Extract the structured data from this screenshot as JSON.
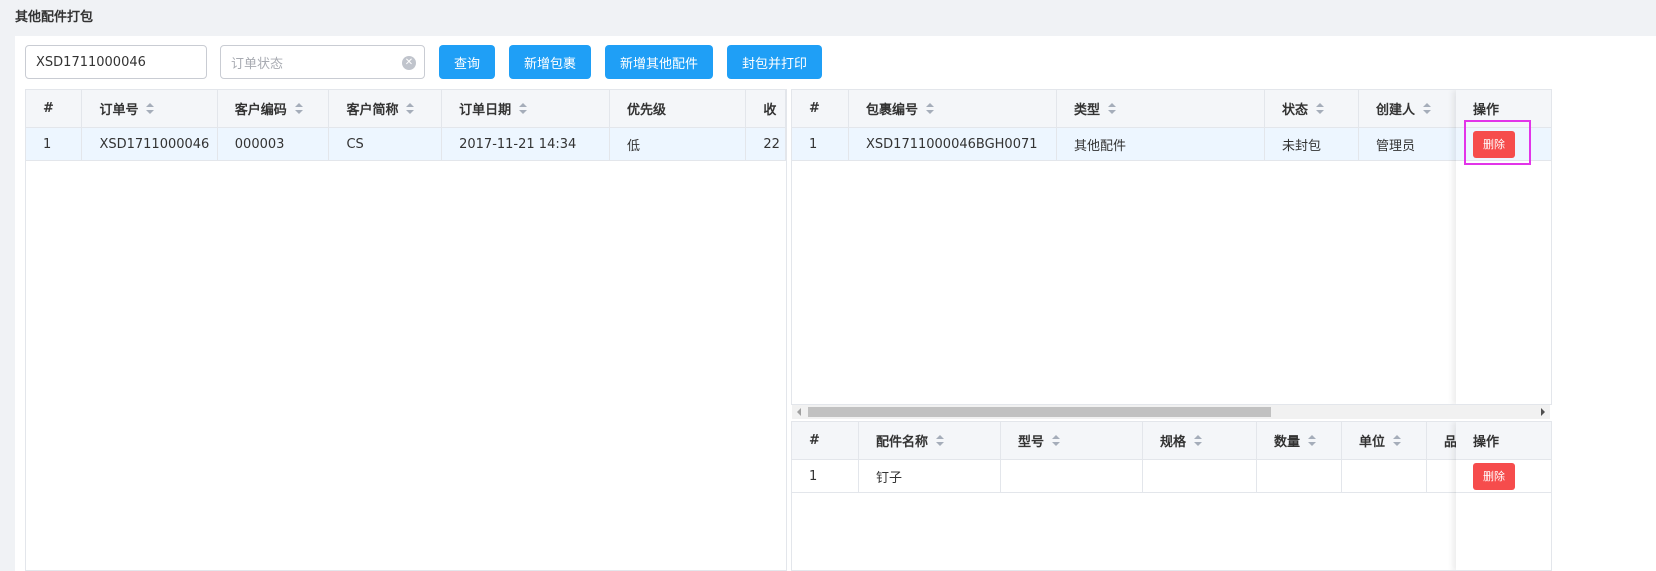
{
  "page": {
    "title": "其他配件打包"
  },
  "search": {
    "order_value": "XSD1711000046",
    "status_placeholder": "订单状态"
  },
  "buttons": {
    "query": "查询",
    "add_package": "新增包裹",
    "add_other_parts": "新增其他配件",
    "seal_print": "封包并打印"
  },
  "orders": {
    "columns": [
      "#",
      "订单号",
      "客户编码",
      "客户简称",
      "订单日期",
      "优先级",
      "收"
    ],
    "rows": [
      {
        "idx": "1",
        "order_no": "XSD1711000046",
        "customer_code": "000003",
        "customer_short": "CS",
        "order_date": "2017-11-21 14:34",
        "priority": "低",
        "recv": "22"
      }
    ]
  },
  "packages": {
    "columns": [
      "#",
      "包裹编号",
      "类型",
      "状态",
      "创建人",
      "操作"
    ],
    "rows": [
      {
        "idx": "1",
        "package_no": "XSD1711000046BGH0071",
        "type": "其他配件",
        "status": "未封包",
        "creator": "管理员",
        "action": "删除"
      }
    ]
  },
  "parts": {
    "columns": [
      "#",
      "配件名称",
      "型号",
      "规格",
      "数量",
      "单位",
      "品",
      "操作"
    ],
    "rows": [
      {
        "idx": "1",
        "name": "钉子",
        "model": "",
        "spec": "",
        "qty": "",
        "unit": "",
        "brand": "",
        "action": "删除"
      }
    ]
  }
}
